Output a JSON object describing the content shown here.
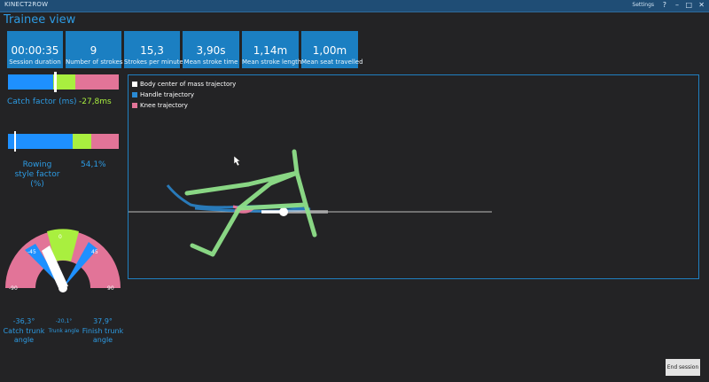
{
  "app": {
    "title": "KINECT2ROW",
    "settings_label": "Settings",
    "window_buttons": [
      "?",
      "–",
      "□",
      "✕"
    ]
  },
  "page_title": "Trainee view",
  "stats": [
    {
      "value": "00:00:35",
      "label": "Session duration"
    },
    {
      "value": "9",
      "label": "Number of strokes"
    },
    {
      "value": "15,3",
      "label": "Strokes per minute"
    },
    {
      "value": "3,90s",
      "label": "Mean stroke time"
    },
    {
      "value": "1,14m",
      "label": "Mean stroke length"
    },
    {
      "value": "1,00m",
      "label": "Mean seat travelled"
    }
  ],
  "catch_factor": {
    "label": "Catch factor (ms)",
    "value": "-27,8ms"
  },
  "rowing_style": {
    "label": "Rowing style factor (%)",
    "value": "54,1%"
  },
  "legend": [
    {
      "label": "Body center of mass trajectory",
      "color": "#ffffff"
    },
    {
      "label": "Handle trajectory",
      "color": "#2a8ad4"
    },
    {
      "label": "Knee trajectory",
      "color": "#e27498"
    }
  ],
  "gauge": {
    "ticks": {
      "min": "-90",
      "mid": "0",
      "max": "90",
      "neg45": "-45",
      "pos45": "45"
    },
    "catch": {
      "value": "-36,3°",
      "label": "Catch trunk angle"
    },
    "trunk": {
      "value": "-20,1°",
      "label": "Trunk angle"
    },
    "finish": {
      "value": "37,9°",
      "label": "Finish trunk angle"
    }
  },
  "colors": {
    "accent": "#1b7fc2",
    "pink": "#e27498",
    "green": "#a9ef3f",
    "blue": "#1e90ff",
    "skeleton": "#8fe08a"
  },
  "end_session_label": "End session"
}
